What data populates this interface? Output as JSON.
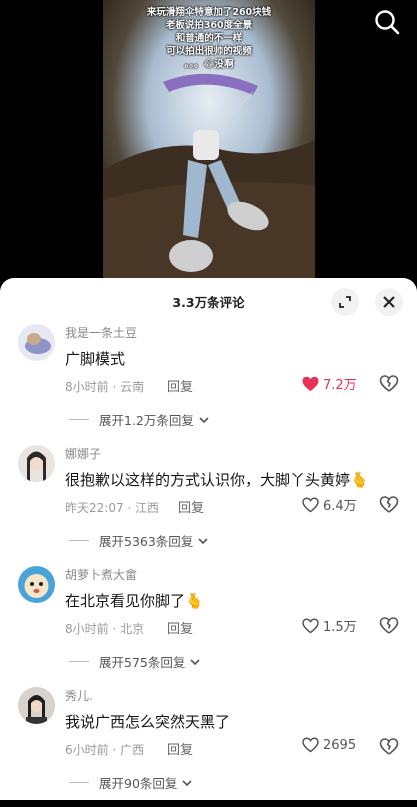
{
  "video": {
    "caption_lines": [
      "来玩滑翔伞特意加了260块钱",
      "老板说拍360度全景",
      "和普通的不一样",
      "可以拍出很帅的视频",
      "。。。😂没啊"
    ]
  },
  "sheet": {
    "title": "3.3万条评论"
  },
  "comments": [
    {
      "username": "我是一条土豆",
      "text": "广脚模式",
      "emoji": "",
      "time_location": "8小时前 · 云南",
      "reply_label": "回复",
      "likes": "7.2万",
      "liked": true,
      "expand_label": "展开1.2万条回复"
    },
    {
      "username": "娜娜子",
      "text": "很抱歉以这样的方式认识你，大脚丫头黄婷",
      "emoji": "🫰",
      "time_location": "昨天22:07 · 江西",
      "reply_label": "回复",
      "likes": "6.4万",
      "liked": false,
      "expand_label": "展开5363条回复"
    },
    {
      "username": "胡萝卜煮大畲",
      "text": "在北京看见你脚了",
      "emoji": "🫰",
      "time_location": "8小时前 · 北京",
      "reply_label": "回复",
      "likes": "1.5万",
      "liked": false,
      "expand_label": "展开575条回复"
    },
    {
      "username": "秀儿.",
      "text": "我说广西怎么突然天黑了",
      "emoji": "",
      "time_location": "6小时前 · 广西",
      "reply_label": "回复",
      "likes": "2695",
      "liked": false,
      "expand_label": "展开90条回复"
    }
  ],
  "colors": {
    "liked": "#e83255"
  }
}
